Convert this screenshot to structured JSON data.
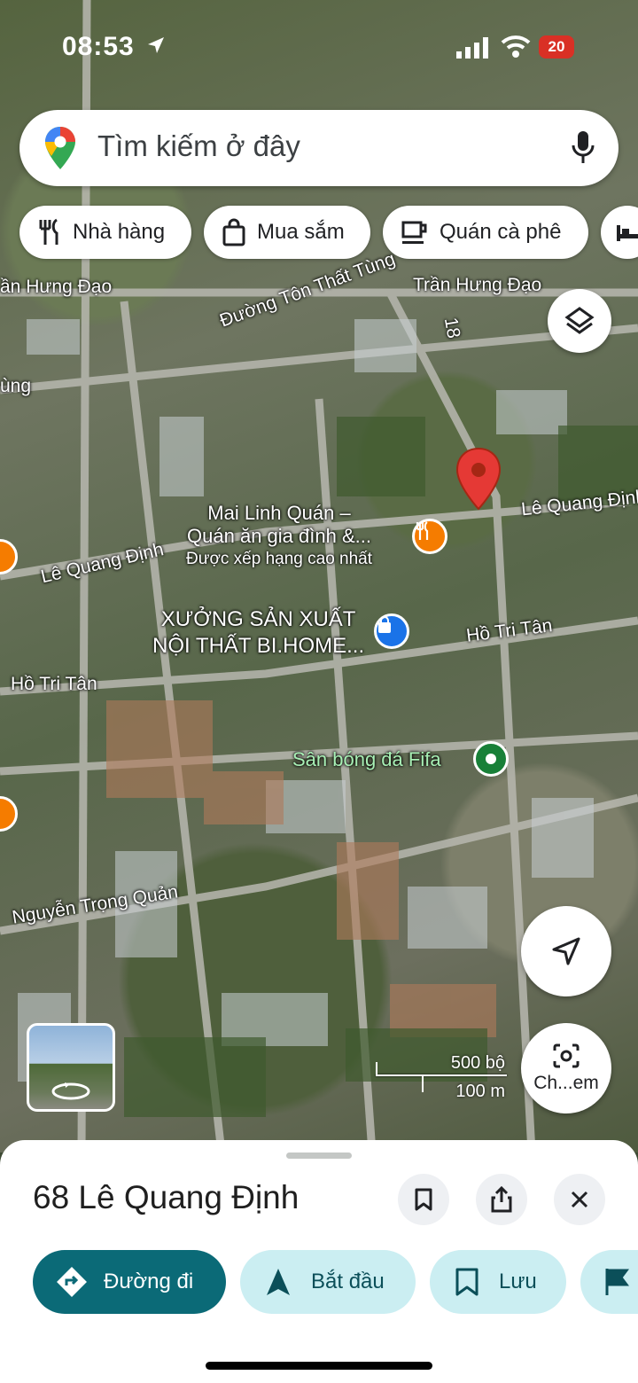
{
  "status_bar": {
    "time": "08:53",
    "battery": "20"
  },
  "search": {
    "placeholder": "Tìm kiếm ở đây"
  },
  "chips": [
    {
      "label": "Nhà hàng",
      "icon": "restaurant-icon"
    },
    {
      "label": "Mua sắm",
      "icon": "shopping-bag-icon"
    },
    {
      "label": "Quán cà phê",
      "icon": "coffee-icon"
    },
    {
      "label": "",
      "icon": "hotel-bed-icon"
    }
  ],
  "map": {
    "streets": {
      "tran_hung_dao_left": "ần Hưng Đạo",
      "ton_that_tung": "Đường Tôn Thất Tùng",
      "tran_hung_dao_right": "Trần Hưng Đạo",
      "road_18": "18",
      "ung": "ùng",
      "le_quang_dinh_right": "Lê Quang Định",
      "le_quang_dinh_left": "Lê Quang Định",
      "ho_tri_tan_right": "Hồ Tri Tân",
      "ho_tri_tan_left": "Hồ Tri Tân",
      "nguyen_trong_quan": "Nguyễn Trọng Quản"
    },
    "pois": {
      "restaurant": {
        "line1": "Mai Linh Quán –",
        "line2": "Quán ăn gia đình &...",
        "line3": "Được xếp hạng cao nhất"
      },
      "shop": {
        "line1": "XƯỞNG SẢN XUẤT",
        "line2": "NỘI THẤT BI.HOME..."
      },
      "stadium": {
        "name": "Sân bóng đá Fifa"
      }
    },
    "scale": {
      "imperial": "500 bộ",
      "metric": "100 m"
    },
    "camera_label": "Ch...em",
    "colors": {
      "pin": "#e53935",
      "restaurant": "#f57c00",
      "shop": "#1a73e8",
      "stadium": "#188038"
    }
  },
  "sheet": {
    "address": "68 Lê Quang Định",
    "actions": [
      {
        "label": "Đường đi",
        "icon": "directions-icon"
      },
      {
        "label": "Bắt đầu",
        "icon": "navigation-arrow-icon"
      },
      {
        "label": "Lưu",
        "icon": "bookmark-icon"
      },
      {
        "label": "",
        "icon": "flag-icon"
      }
    ],
    "accent": "#0b6a77"
  }
}
